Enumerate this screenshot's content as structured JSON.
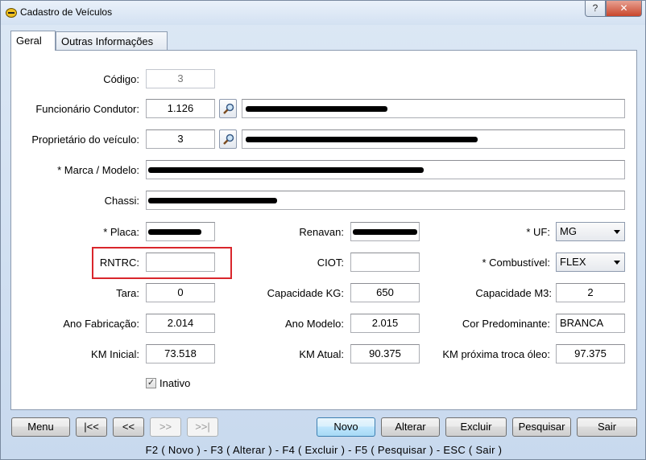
{
  "window": {
    "title": "Cadastro de Veículos",
    "help_label": "?",
    "close_label": "✕"
  },
  "tabs": [
    {
      "label": "Geral"
    },
    {
      "label": "Outras Informações"
    }
  ],
  "fields": {
    "codigo": {
      "label": "Código:",
      "value": "3"
    },
    "funcionario": {
      "label": "Funcionário Condutor:",
      "value": "1.126"
    },
    "proprietario": {
      "label": "Proprietário do veículo:",
      "value": "3"
    },
    "marca": {
      "label": "* Marca / Modelo:"
    },
    "chassi": {
      "label": "Chassi:"
    },
    "placa": {
      "label": "* Placa:"
    },
    "renavan": {
      "label": "Renavan:"
    },
    "uf": {
      "label": "* UF:",
      "value": "MG"
    },
    "rntrc": {
      "label": "RNTRC:",
      "value": ""
    },
    "ciot": {
      "label": "CIOT:",
      "value": ""
    },
    "combustivel": {
      "label": "* Combustível:",
      "value": "FLEX"
    },
    "tara": {
      "label": "Tara:",
      "value": "0"
    },
    "capacidade_kg": {
      "label": "Capacidade KG:",
      "value": "650"
    },
    "capacidade_m3": {
      "label": "Capacidade M3:",
      "value": "2"
    },
    "ano_fabricacao": {
      "label": "Ano Fabricação:",
      "value": "2.014"
    },
    "ano_modelo": {
      "label": "Ano Modelo:",
      "value": "2.015"
    },
    "cor": {
      "label": "Cor Predominante:",
      "value": "BRANCA"
    },
    "km_inicial": {
      "label": "KM Inicial:",
      "value": "73.518"
    },
    "km_atual": {
      "label": "KM Atual:",
      "value": "90.375"
    },
    "km_troca_oleo": {
      "label": "KM próxima troca óleo:",
      "value": "97.375"
    },
    "inativo": {
      "label": "Inativo",
      "checked": true,
      "mark": "✓"
    }
  },
  "buttons": {
    "menu": "Menu",
    "first": "|<<",
    "prev": "<<",
    "next": ">>",
    "last": ">>|",
    "novo": "Novo",
    "alterar": "Alterar",
    "excluir": "Excluir",
    "pesquisar": "Pesquisar",
    "sair": "Sair"
  },
  "shortcuts": "F2 ( Novo )  -  F3 ( Alterar )  -  F4 ( Excluir )  -  F5 ( Pesquisar )  -  ESC ( Sair )",
  "colors": {
    "highlight": "#d9262c",
    "window_bg": "#dbe6f3"
  }
}
